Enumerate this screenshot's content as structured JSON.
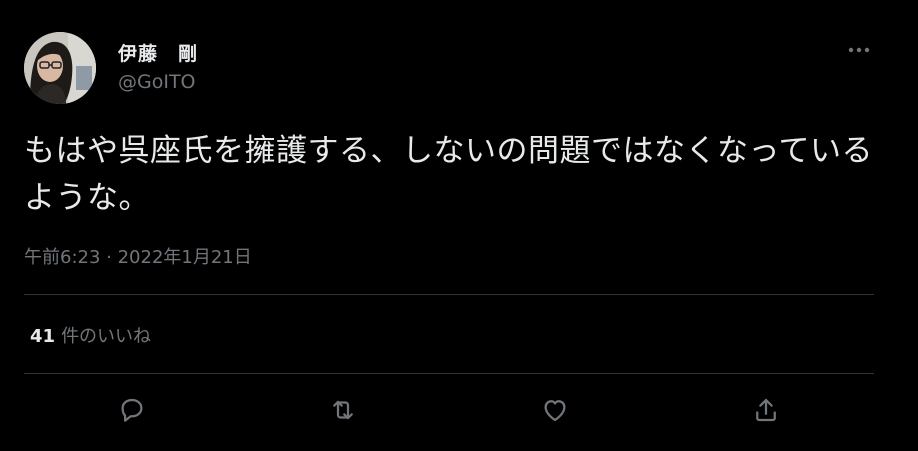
{
  "author": {
    "display_name": "伊藤　剛",
    "handle": "@GoITO"
  },
  "tweet": {
    "text": "もはや呉座氏を擁護する、しないの問題ではなくなっているような。",
    "timestamp": "午前6:23 · 2022年1月21日"
  },
  "likes": {
    "count": "41",
    "label": "件のいいね"
  },
  "icons": {
    "more": "more-icon",
    "reply": "reply-icon",
    "retweet": "retweet-icon",
    "like": "heart-icon",
    "share": "share-icon"
  },
  "colors": {
    "background": "#000000",
    "text_primary": "#e7e9ea",
    "text_secondary": "#71767b",
    "divider": "#2f3336"
  }
}
